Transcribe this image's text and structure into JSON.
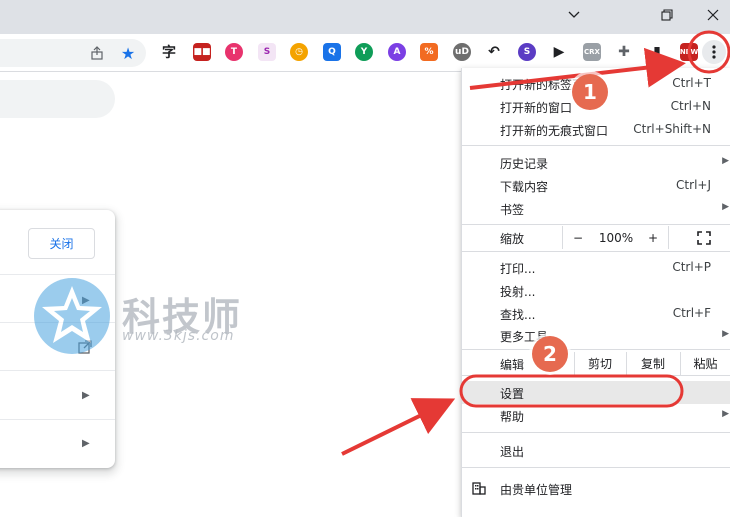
{
  "window": {
    "minimize_icon": "chevron-down-icon",
    "restore_icon": "restore-icon",
    "close_icon": "close-icon"
  },
  "toolbar": {
    "extensions": [
      {
        "id": "zi",
        "glyph": "字",
        "color": "#202124",
        "bg": "transparent"
      },
      {
        "id": "red-tag",
        "glyph": "■■",
        "color": "#ffffff",
        "bg": "#c5221f"
      },
      {
        "id": "t-red",
        "glyph": "T",
        "color": "#ffffff",
        "bg": "#e8336d"
      },
      {
        "id": "purple-s",
        "glyph": "S",
        "color": "#9c27b0",
        "bg": "#f3e5f5"
      },
      {
        "id": "clock-orange",
        "glyph": "◷",
        "color": "#ffffff",
        "bg": "#f4a300"
      },
      {
        "id": "q-blue",
        "glyph": "Q",
        "color": "#ffffff",
        "bg": "#1a73e8"
      },
      {
        "id": "y-green",
        "glyph": "Y",
        "color": "#ffffff",
        "bg": "#0f9d58"
      },
      {
        "id": "a-purple",
        "glyph": "A",
        "color": "#ffffff",
        "bg": "#7b3fe4"
      },
      {
        "id": "orange-tag",
        "glyph": "%",
        "color": "#ffffff",
        "bg": "#f26b21"
      },
      {
        "id": "ub-shield",
        "glyph": "uD",
        "color": "#ffffff",
        "bg": "#6e6e6e"
      },
      {
        "id": "refresh-dark",
        "glyph": "↶",
        "color": "#202124",
        "bg": "transparent"
      },
      {
        "id": "s-gradient",
        "glyph": "S",
        "color": "#ffffff",
        "bg": "#5b3cc4"
      },
      {
        "id": "play-circle",
        "glyph": "▶",
        "color": "#202124",
        "bg": "transparent"
      },
      {
        "id": "crx",
        "glyph": "CRX",
        "color": "#ffffff",
        "bg": "#9aa0a6"
      },
      {
        "id": "puzzle",
        "glyph": "✚",
        "color": "#5f6368",
        "bg": "transparent"
      },
      {
        "id": "side-panel",
        "glyph": "▮",
        "color": "#202124",
        "bg": "transparent"
      },
      {
        "id": "new-badge",
        "glyph": "NEW",
        "color": "#ffffff",
        "bg": "#c5221f"
      }
    ],
    "more_icon": "more-vert-icon"
  },
  "card": {
    "close_label": "关闭"
  },
  "watermark": {
    "title": "科技师",
    "url": "www.3kjs.com"
  },
  "menu": {
    "new_tab": {
      "label": "打开新的标签页",
      "shortcut": "Ctrl+T"
    },
    "new_window": {
      "label": "打开新的窗口",
      "shortcut": "Ctrl+N"
    },
    "incognito": {
      "label": "打开新的无痕式窗口",
      "shortcut": "Ctrl+Shift+N"
    },
    "history": {
      "label": "历史记录"
    },
    "downloads": {
      "label": "下载内容",
      "shortcut": "Ctrl+J"
    },
    "bookmarks": {
      "label": "书签"
    },
    "zoom": {
      "label": "缩放",
      "minus": "−",
      "value": "100%",
      "plus": "+"
    },
    "print": {
      "label": "打印...",
      "shortcut": "Ctrl+P"
    },
    "cast": {
      "label": "投射..."
    },
    "find": {
      "label": "查找...",
      "shortcut": "Ctrl+F"
    },
    "more_tools": {
      "label": "更多工具"
    },
    "edit": {
      "label": "编辑",
      "cut": "剪切",
      "copy": "复制",
      "paste": "粘贴"
    },
    "settings": {
      "label": "设置"
    },
    "help": {
      "label": "帮助"
    },
    "exit": {
      "label": "退出"
    },
    "managed": {
      "label": "由贵单位管理"
    }
  },
  "annotations": {
    "step1": "1",
    "step2": "2",
    "color": "#e53935"
  }
}
